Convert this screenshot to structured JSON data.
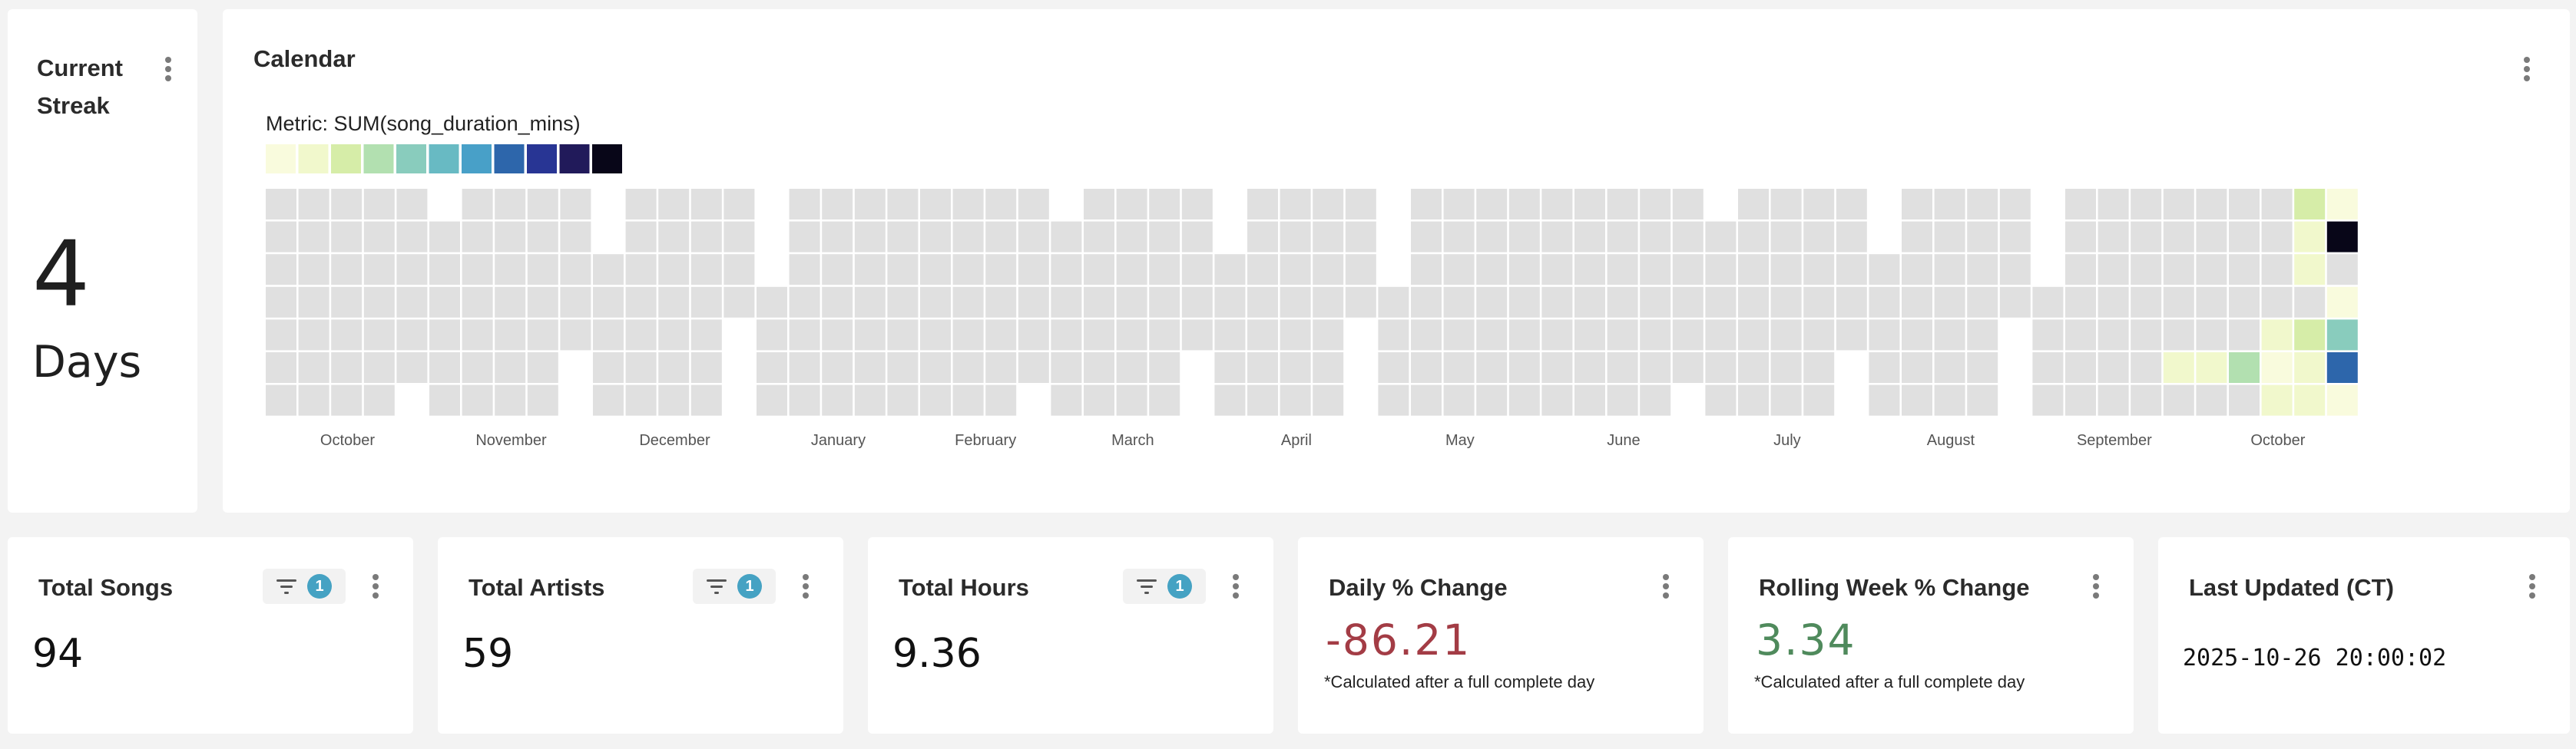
{
  "streak": {
    "title": "Current Streak",
    "value": "4",
    "unit": "Days"
  },
  "calendar": {
    "title": "Calendar",
    "metric_label": "Metric: SUM(song_duration_mins)",
    "legend_colors": [
      "#f9fbdd",
      "#f1f8cc",
      "#d6eda8",
      "#b2e0b0",
      "#89ccbd",
      "#68bac3",
      "#48a0c8",
      "#2d66ab",
      "#283594",
      "#211a5a",
      "#080618"
    ],
    "month_labels": [
      "October",
      "November",
      "December",
      "January",
      "February",
      "March",
      "April",
      "May",
      "June",
      "July",
      "August",
      "September",
      "October"
    ],
    "empty_color": "#e0e0e0",
    "active_weeks": [
      [
        "#e0e0e0",
        "#e0e0e0",
        "#e0e0e0",
        "#e0e0e0",
        "#e0e0e0",
        "#e0e0e0",
        "#e0e0e0"
      ],
      [
        "#e0e0e0",
        "#e0e0e0",
        "#e0e0e0",
        "#e0e0e0",
        "#e0e0e0",
        "#e0e0e0",
        "#e0e0e0"
      ],
      [
        "#e0e0e0",
        "#e0e0e0",
        "#e0e0e0",
        "#e0e0e0",
        "#e0e0e0",
        "#e0e0e0",
        "#e0e0e0"
      ]
    ]
  },
  "chart_data": {
    "type": "heatmap",
    "title": "Calendar",
    "metric": "Metric: SUM(song_duration_mins)",
    "x_labels": [
      "October",
      "November",
      "December",
      "January",
      "February",
      "March",
      "April",
      "May",
      "June",
      "July",
      "August",
      "September",
      "October"
    ],
    "rows": 7,
    "weeks": 54,
    "nonzero_cells": [
      {
        "week": 50,
        "day": 5,
        "level": 3
      },
      {
        "week": 51,
        "day": 4,
        "level": 1
      },
      {
        "week": 51,
        "day": 5,
        "level": 0
      },
      {
        "week": 51,
        "day": 6,
        "level": 1
      },
      {
        "week": 52,
        "day": 0,
        "level": 2
      },
      {
        "week": 52,
        "day": 1,
        "level": 1
      },
      {
        "week": 52,
        "day": 2,
        "level": 1
      },
      {
        "week": 52,
        "day": 4,
        "level": 2
      },
      {
        "week": 52,
        "day": 5,
        "level": 1
      },
      {
        "week": 52,
        "day": 6,
        "level": 1
      },
      {
        "week": 53,
        "day": 0,
        "level": 0
      },
      {
        "week": 53,
        "day": 1,
        "level": 10
      },
      {
        "week": 53,
        "day": 3,
        "level": 0
      },
      {
        "week": 53,
        "day": 4,
        "level": 4
      },
      {
        "week": 53,
        "day": 5,
        "level": 7
      },
      {
        "week": 53,
        "day": 6,
        "level": 0
      },
      {
        "week": 49,
        "day": 5,
        "level": 1
      }
    ]
  },
  "tiles": [
    {
      "title": "Total Songs",
      "value": "94",
      "badge": "1"
    },
    {
      "title": "Total Artists",
      "value": "59",
      "badge": "1"
    },
    {
      "title": "Total Hours",
      "value": "9.36",
      "badge": "1"
    }
  ],
  "daily": {
    "title": "Daily % Change",
    "value": "-86.21",
    "note": "*Calculated after a full complete day",
    "color": "#a33c45"
  },
  "rolling": {
    "title": "Rolling Week % Change",
    "value": "3.34",
    "note": "*Calculated after a full complete day",
    "color": "#4f8a5c"
  },
  "updated": {
    "title": "Last Updated (CT)",
    "value": "2025-10-26 20:00:02"
  }
}
